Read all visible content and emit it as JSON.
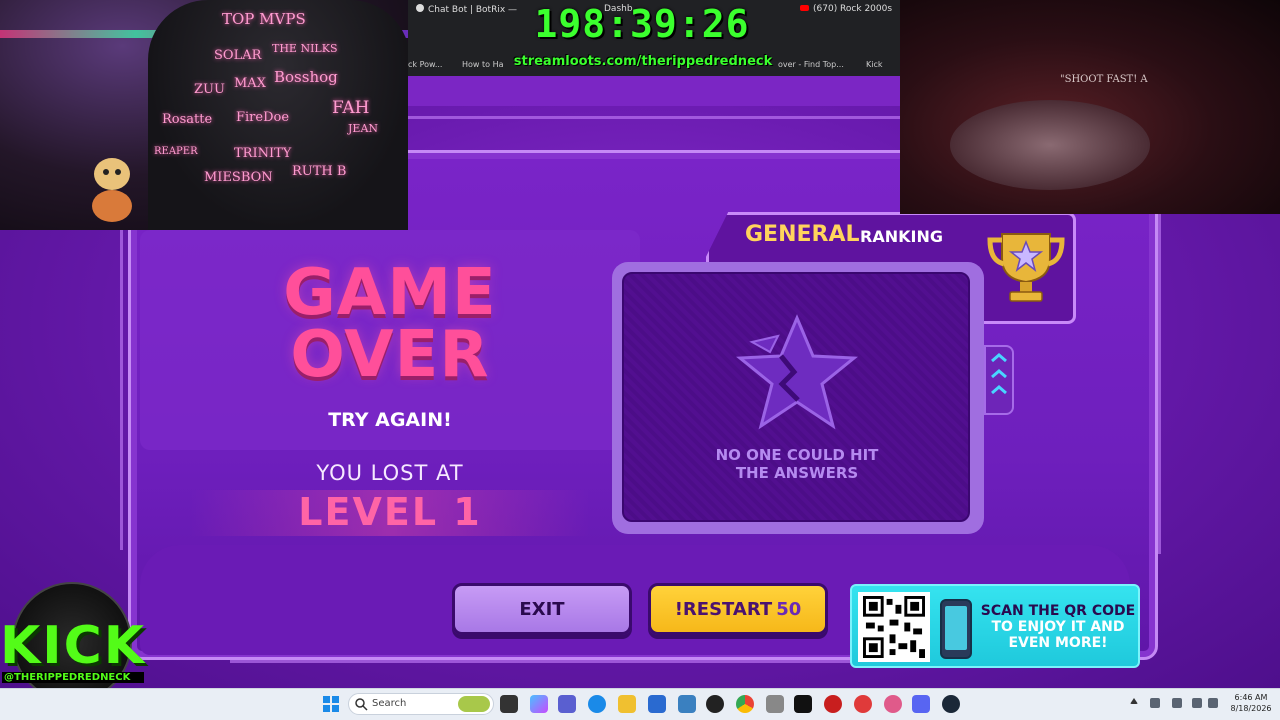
{
  "browser": {
    "tabs": [
      "Chat Bot | BotRix —",
      "Dashb",
      "(670) Rock 2000s"
    ],
    "bookmarks": [
      "ck Pow...",
      "How to Ha",
      "over - Find Top...",
      "Kick"
    ]
  },
  "overlay": {
    "timer": "198:39:26",
    "streamloots": "streamloots.com/therippedredneck"
  },
  "cam_left": {
    "signatures": [
      "TOP MVPS",
      "SOLAR",
      "THE NILKS",
      "ZUU",
      "MAX",
      "Bosshog",
      "Rosatte",
      "FireDoe",
      "FAH",
      "JEAN",
      "REAPER",
      "TRINITY",
      "MIESBON",
      "RUTH B"
    ]
  },
  "cam_right": {
    "sign_text": "\"SHOOT FAST! A"
  },
  "game": {
    "game_over": "GAME OVER",
    "try_again": "TRY AGAIN!",
    "lost_at": "YOU LOST AT",
    "level": "LEVEL 1",
    "ranking_general": "GENERAL",
    "ranking_label": "RANKING",
    "no_one": "NO ONE COULD HIT THE ANSWERS",
    "exit": "EXIT",
    "restart": "!RESTART",
    "restart_cost": "50",
    "qr_text_1": "SCAN THE QR CODE",
    "qr_text_2": "TO ENJOY IT AND EVEN MORE!"
  },
  "kick": {
    "logo": "KICK",
    "handle": "@THERIPPEDREDNECK"
  },
  "taskbar": {
    "search_placeholder": "Search",
    "time": "6:46 AM",
    "date": "8/18/2026"
  },
  "colors": {
    "game_purple": "#6e1fbd",
    "game_over_pink": "#ff4f9a",
    "restart_yellow": "#f6b81a",
    "qr_cyan": "#1fc9dc",
    "timer_green": "#3bff2e",
    "kick_green": "#53fc18",
    "ranking_gold": "#ffd45c"
  }
}
